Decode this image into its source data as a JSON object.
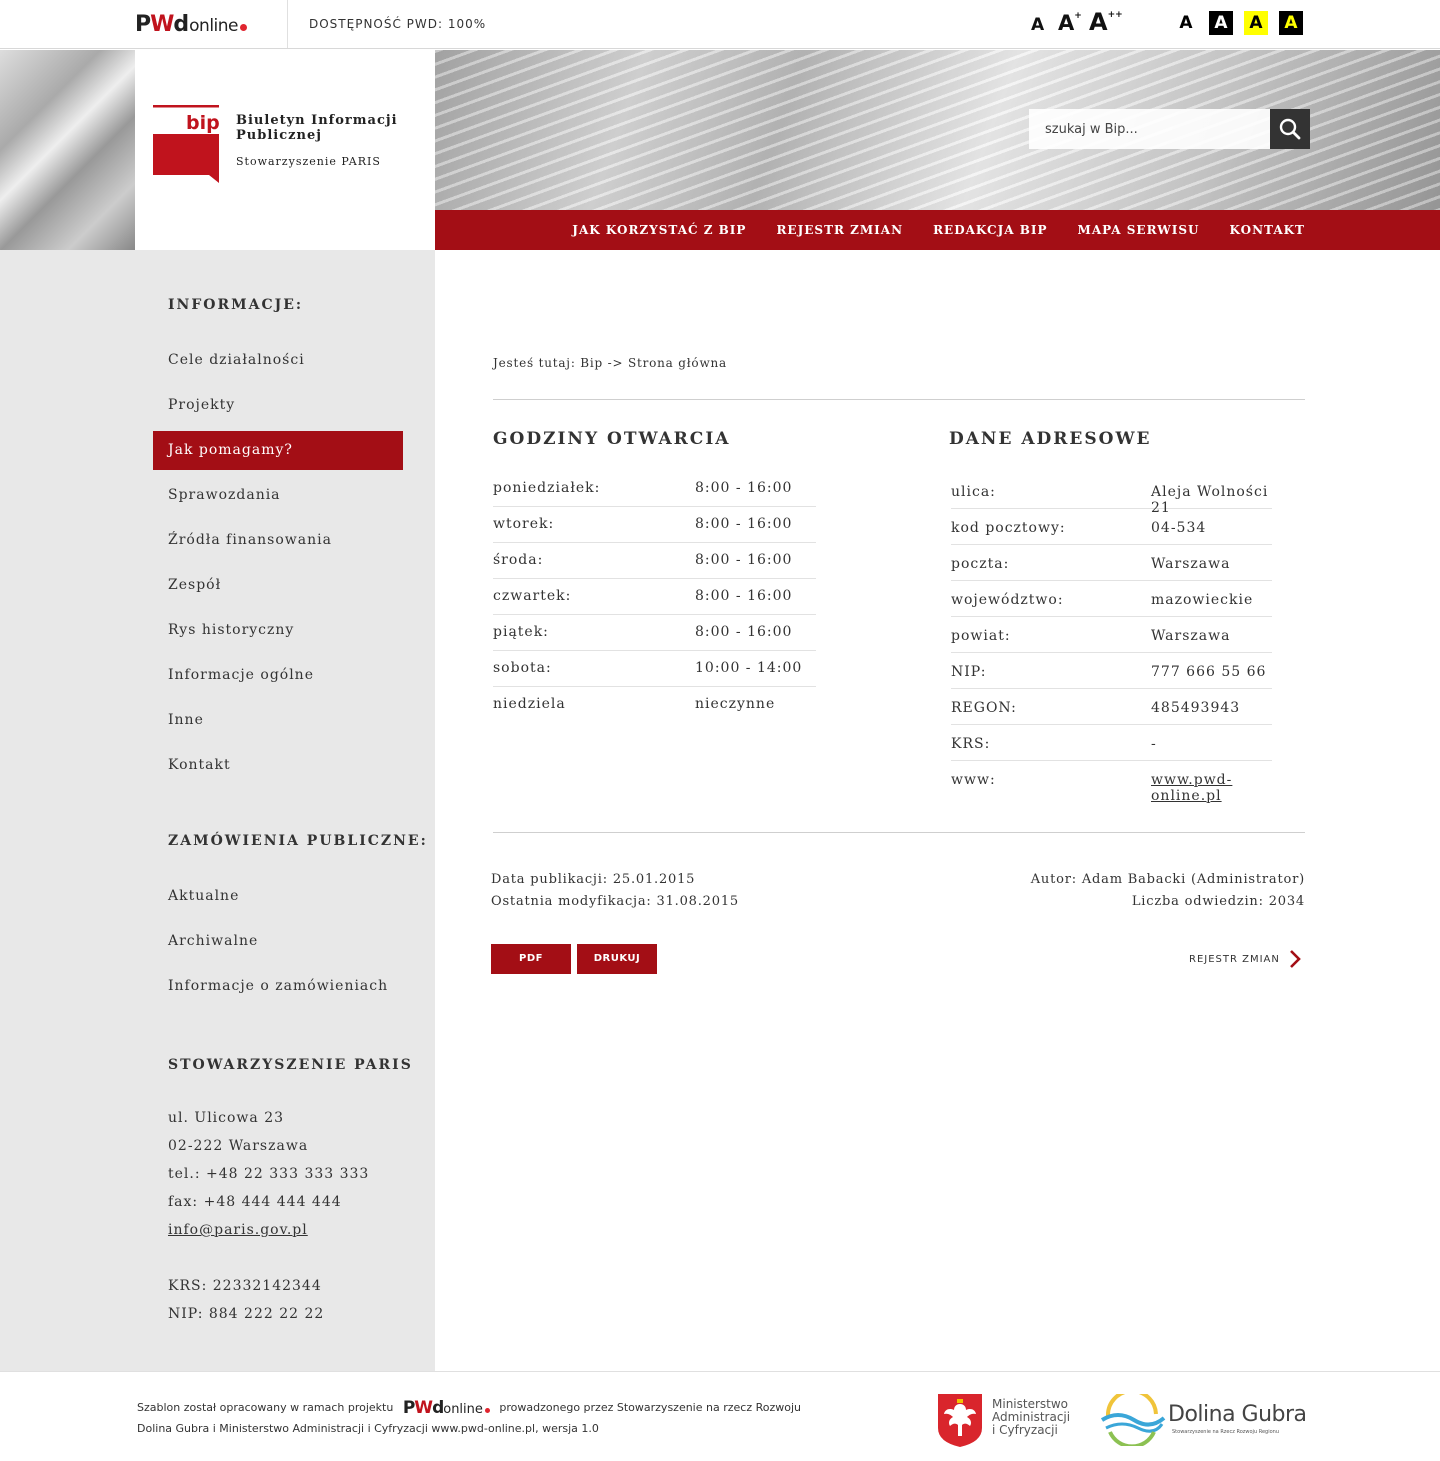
{
  "topbar": {
    "pwd_logo": {
      "p": "P",
      "w": "W",
      "d": "d",
      "online": "online"
    },
    "accessibility_label": "DOSTĘPNOŚĆ PWD: 100%",
    "font_sizes": [
      {
        "label": "A",
        "sup": ""
      },
      {
        "label": "A",
        "sup": "+"
      },
      {
        "label": "A",
        "sup": "++"
      }
    ],
    "contrast_options": [
      {
        "label": "A",
        "bg": "#ffffff",
        "fg": "#000000"
      },
      {
        "label": "A",
        "bg": "#000000",
        "fg": "#ffffff"
      },
      {
        "label": "A",
        "bg": "#ffff00",
        "fg": "#000000"
      },
      {
        "label": "A",
        "bg": "#000000",
        "fg": "#ffff00"
      }
    ]
  },
  "header": {
    "bip_logo_text": "bip",
    "title": "Biuletyn Informacji Publicznej",
    "subtitle": "Stowarzyszenie PARIS",
    "search_placeholder": "szukaj w Bip...",
    "nav": [
      "JAK KORZYSTAĆ Z BIP",
      "REJESTR ZMIAN",
      "REDAKCJA BIP",
      "MAPA SERWISU",
      "KONTAKT"
    ]
  },
  "sidebar": {
    "info_heading": "INFORMACJE:",
    "info_items": [
      "Cele działalności",
      "Projekty",
      "Jak pomagamy?",
      "Sprawozdania",
      "Źródła finansowania",
      "Zespół",
      "Rys historyczny",
      "Informacje ogólne",
      "Inne",
      "Kontakt"
    ],
    "active_index": 2,
    "orders_heading": "ZAMÓWIENIA PUBLICZNE:",
    "orders_items": [
      "Aktualne",
      "Archiwalne",
      "Informacje o zamówieniach"
    ],
    "org_heading": "STOWARZYSZENIE PARIS",
    "org_lines": [
      "ul. Ulicowa 23",
      "02-222 Warszawa",
      "tel.: +48 22 333 333 333",
      "fax: +48 444 444 444"
    ],
    "org_email": "info@paris.gov.pl",
    "org_ids": [
      "KRS: 22332142344",
      "NIP: 884 222 22 22"
    ]
  },
  "content": {
    "breadcrumb": "Jesteś tutaj: Bip -> Strona główna",
    "hours_title": "GODZINY OTWARCIA",
    "hours": [
      {
        "day": "poniedziałek:",
        "time": "8:00 - 16:00"
      },
      {
        "day": "wtorek:",
        "time": "8:00 - 16:00"
      },
      {
        "day": "środa:",
        "time": "8:00 - 16:00"
      },
      {
        "day": "czwartek:",
        "time": "8:00 - 16:00"
      },
      {
        "day": "piątek:",
        "time": "8:00 - 16:00"
      },
      {
        "day": "sobota:",
        "time": "10:00 - 14:00"
      },
      {
        "day": "niedziela",
        "time": "nieczynne"
      }
    ],
    "address_title": "DANE ADRESOWE",
    "address": [
      {
        "key": "ulica:",
        "value": "Aleja Wolności 21"
      },
      {
        "key": "kod pocztowy:",
        "value": "04-534"
      },
      {
        "key": "poczta:",
        "value": "Warszawa"
      },
      {
        "key": "województwo:",
        "value": "mazowieckie"
      },
      {
        "key": "powiat:",
        "value": "Warszawa"
      },
      {
        "key": "NIP:",
        "value": "777 666 55 66"
      },
      {
        "key": "REGON:",
        "value": "485493943"
      },
      {
        "key": "KRS:",
        "value": "-"
      },
      {
        "key": "www:",
        "value": "www.pwd-online.pl"
      }
    ],
    "published": "Data publikacji: 25.01.2015",
    "modified": "Ostatnia modyfikacja: 31.08.2015",
    "author": "Autor: Adam Babacki (Administrator)",
    "visits": "Liczba odwiedzin: 2034",
    "pdf_button": "PDF",
    "print_button": "DRUKUJ",
    "changes_link": "REJESTR ZMIAN"
  },
  "footer": {
    "text_before": "Szablon został opracowany w ramach projektu",
    "text_after": "prowadzonego przez Stowarzyszenie na rzecz Rozwoju Dolina Gubra i Ministerstwo Administracji i Cyfryzacji www.pwd-online.pl, wersja 1.0",
    "ministry_lines": [
      "Ministerstwo",
      "Administracji",
      "i Cyfryzacji"
    ],
    "dolina_name": "Dolina Gubra",
    "dolina_sub": "Stowarzyszenie na Rzecz Rozwoju Regionu"
  },
  "colors": {
    "brand_red": "#a30e15",
    "sidebar_bg": "#e8e8e8"
  }
}
